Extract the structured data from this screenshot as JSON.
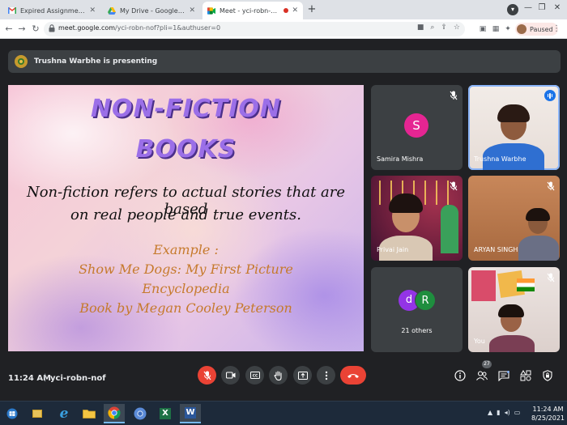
{
  "browser": {
    "tabs": [
      {
        "label": "Expired Assignment Request: libr",
        "icon": "gmail-icon",
        "active": false
      },
      {
        "label": "My Drive - Google Drive",
        "icon": "google-drive-icon",
        "active": false
      },
      {
        "label": "Meet - yci-robn-nof",
        "icon": "google-meet-icon",
        "active": true
      }
    ],
    "url_host": "meet.google.com",
    "url_path": "/yci-robn-nof?pli=1&authuser=0",
    "profile_label": "Paused"
  },
  "meet": {
    "presenter_banner": "Trushna Warbhe is presenting",
    "slide": {
      "title_line1": "NON-FICTION",
      "title_line2": "BOOKS",
      "body_line1": "Non-fiction refers to actual stories that are based",
      "body_line2": "on real people and true events.",
      "example_line1": "Example :",
      "example_line2": "Show Me Dogs: My First Picture",
      "example_line3": "Encyclopedia",
      "example_line4": "Book by Megan Cooley Peterson"
    },
    "participants": [
      {
        "name": "Samira Mishra",
        "avatar_letter": "S",
        "muted": true
      },
      {
        "name": "Trushna Warbhe",
        "speaking": true
      },
      {
        "name": "Privai Jain",
        "muted": true
      },
      {
        "name": "ARYAN SINGH",
        "muted": true
      },
      {
        "name": "21 others",
        "avatar_letters": [
          "d",
          "R"
        ]
      },
      {
        "name": "You",
        "muted": true
      }
    ],
    "time": "11:24 AM",
    "separator": "|",
    "meeting_code": "yci-robn-nof",
    "people_count": "27"
  },
  "taskbar": {
    "time": "11:24 AM",
    "date": "8/25/2021",
    "apps": [
      "file-explorer-icon",
      "internet-explorer-icon",
      "folder-icon",
      "chrome-icon",
      "chrome-alt-icon",
      "excel-icon",
      "word-icon"
    ]
  },
  "colors": {
    "meet_bg": "#202124",
    "tile_bg": "#3c4043",
    "danger_red": "#ea4335",
    "speaking_blue": "#1a73e8",
    "slide_title_purple": "#9b6fe8",
    "slide_example_orange": "#c67a2c"
  }
}
